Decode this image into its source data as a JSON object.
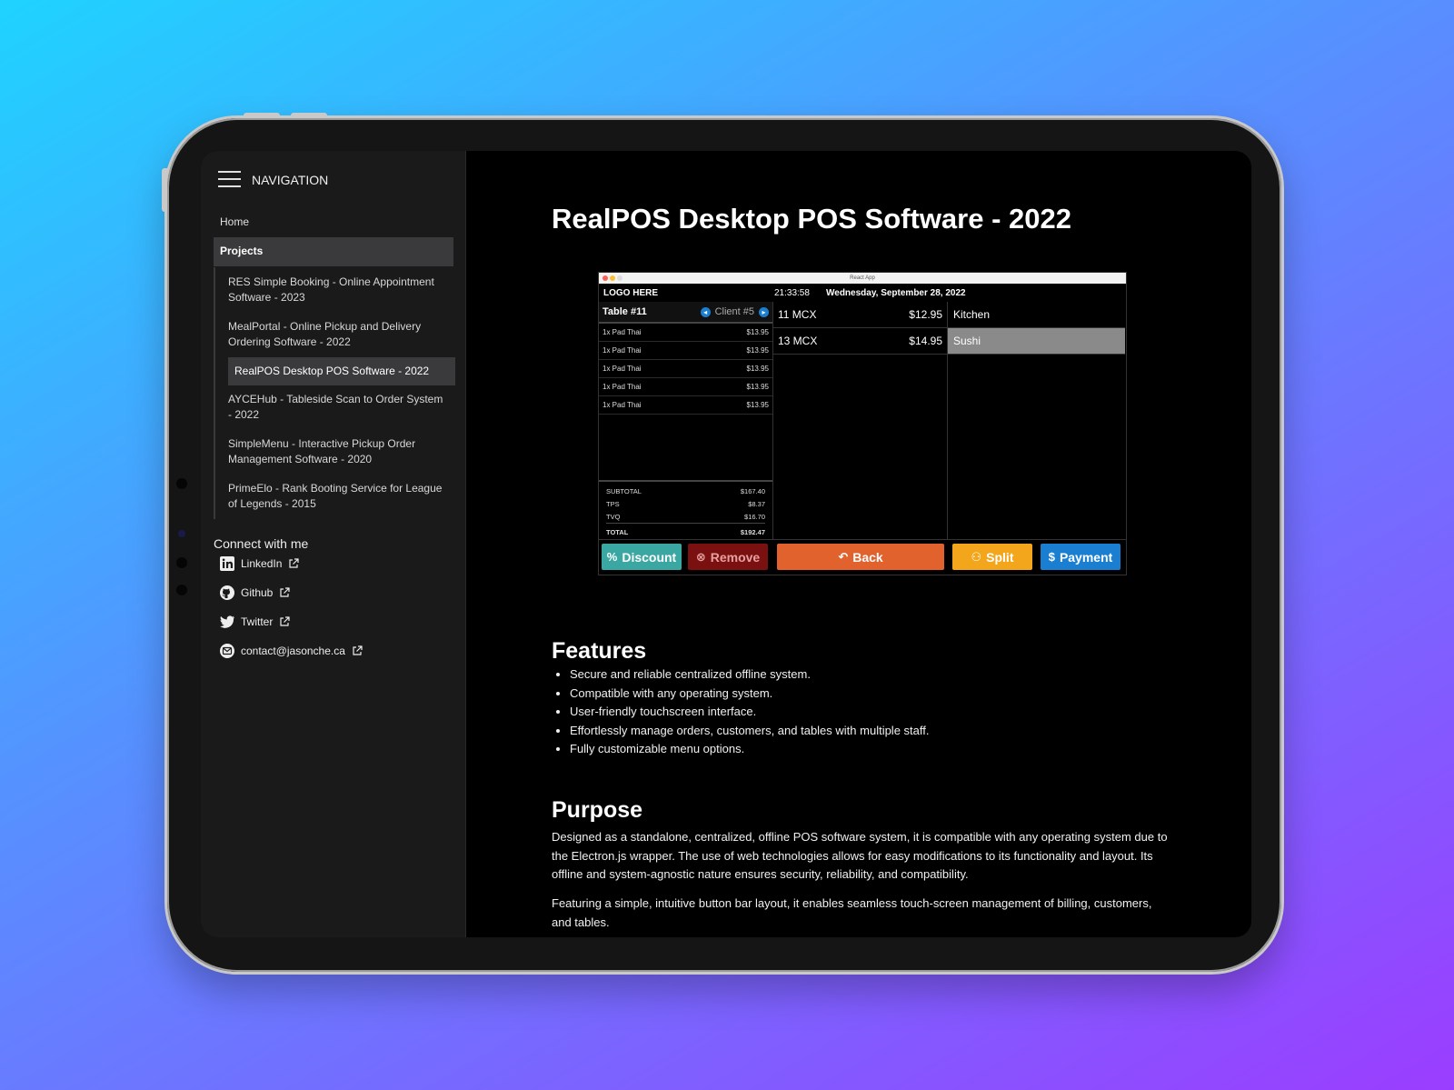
{
  "sidebar": {
    "nav_title": "NAVIGATION",
    "home": "Home",
    "projects_label": "Projects",
    "projects": [
      "RES Simple Booking - Online Appointment Software - 2023",
      "MealPortal - Online Pickup and Delivery Ordering Software - 2022",
      "RealPOS Desktop POS Software - 2022",
      "AYCEHub - Tableside Scan to Order System - 2022",
      "SimpleMenu - Interactive Pickup Order Management Software - 2020",
      "PrimeElo - Rank Booting Service for League of Legends - 2015"
    ],
    "active_project": "RealPOS Desktop POS Software - 2022",
    "connect_label": "Connect with me",
    "social": [
      {
        "label": "LinkedIn",
        "icon": "linkedin-icon"
      },
      {
        "label": "Github",
        "icon": "github-icon"
      },
      {
        "label": "Twitter",
        "icon": "twitter-icon"
      },
      {
        "label": "contact@jasonche.ca",
        "icon": "mail-icon"
      }
    ]
  },
  "main": {
    "title": "RealPOS Desktop POS Software - 2022",
    "pos_screenshot": {
      "window_title": "React App",
      "logo": "LOGO HERE",
      "time": "21:33:58",
      "date": "Wednesday, September 28, 2022",
      "table": "Table #11",
      "client": "Client #5",
      "items": [
        {
          "name": "1x Pad Thai",
          "price": "$13.95"
        },
        {
          "name": "1x Pad Thai",
          "price": "$13.95"
        },
        {
          "name": "1x Pad Thai",
          "price": "$13.95"
        },
        {
          "name": "1x Pad Thai",
          "price": "$13.95"
        },
        {
          "name": "1x Pad Thai",
          "price": "$13.95"
        }
      ],
      "totals": [
        {
          "label": "SUBTOTAL",
          "value": "$167.40"
        },
        {
          "label": "TPS",
          "value": "$8.37"
        },
        {
          "label": "TVQ",
          "value": "$16.70"
        },
        {
          "label": "TOTAL",
          "value": "$192.47"
        }
      ],
      "menu_items": [
        {
          "name": "11 MCX",
          "price": "$12.95"
        },
        {
          "name": "13 MCX",
          "price": "$14.95"
        }
      ],
      "categories": [
        "Kitchen",
        "Sushi"
      ],
      "selected_category": "Sushi",
      "buttons": {
        "discount": "Discount",
        "remove": "Remove",
        "back": "Back",
        "split": "Split",
        "payment": "Payment"
      },
      "colors": {
        "discount": "#3aa7a3",
        "remove": "#7a1010",
        "back": "#e2622d",
        "split": "#f3a61c",
        "payment": "#1b7fd1"
      }
    },
    "features_heading": "Features",
    "features": [
      "Secure and reliable centralized offline system.",
      "Compatible with any operating system.",
      "User-friendly touchscreen interface.",
      "Effortlessly manage orders, customers, and tables with multiple staff.",
      "Fully customizable menu options."
    ],
    "purpose_heading": "Purpose",
    "purpose_p1": "Designed as a standalone, centralized, offline POS software system, it is compatible with any operating system due to the Electron.js wrapper. The use of web technologies allows for easy modifications to its functionality and layout. Its offline and system-agnostic nature ensures security, reliability, and compatibility.",
    "purpose_p2": "Featuring a simple, intuitive button bar layout, it enables seamless touch-screen management of billing, customers, and tables."
  }
}
